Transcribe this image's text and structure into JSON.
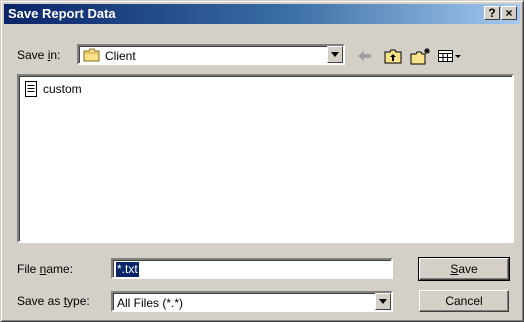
{
  "window": {
    "title": "Save Report Data",
    "help_button": "?",
    "close_button": "×"
  },
  "save_in": {
    "label_prefix": "Save ",
    "label_hotkey": "i",
    "label_suffix": "n:",
    "value": "Client"
  },
  "toolbar": {
    "icons": [
      "back-icon",
      "up-folder-icon",
      "new-folder-icon",
      "view-menu-icon"
    ]
  },
  "files": [
    {
      "name": "custom",
      "icon": "text-file-icon"
    }
  ],
  "file_name": {
    "label_prefix": "File ",
    "label_hotkey": "n",
    "label_suffix": "ame:",
    "value": "*.txt"
  },
  "save_as_type": {
    "label_prefix": "Save as ",
    "label_hotkey": "t",
    "label_suffix": "ype:",
    "value": "All Files (*.*)"
  },
  "buttons": {
    "save_hotkey": "S",
    "save_rest": "ave",
    "cancel": "Cancel"
  },
  "colors": {
    "title_gradient_start": "#0a246a",
    "title_gradient_end": "#a6caf0",
    "dialog_face": "#d4d0c8",
    "selection": "#0a246a"
  }
}
